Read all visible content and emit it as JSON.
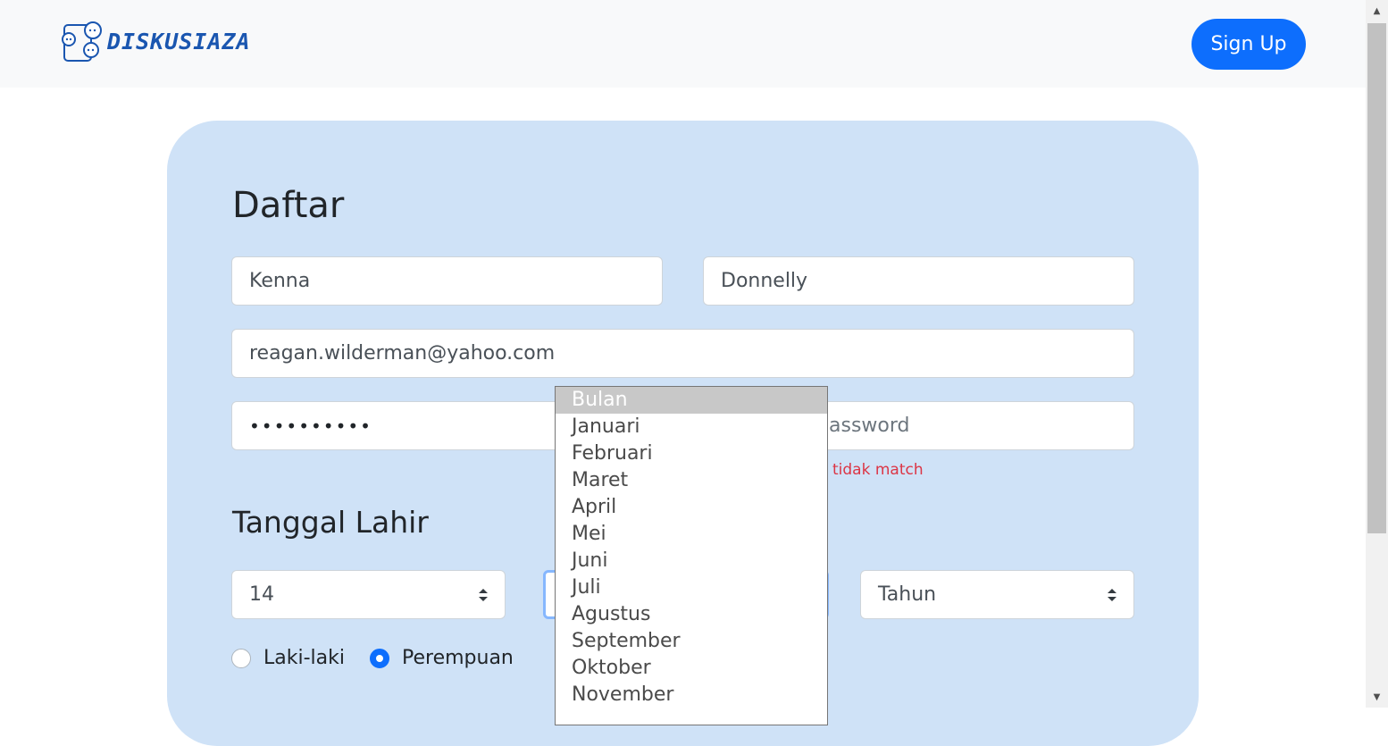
{
  "header": {
    "brand": "DISKUSIAZA",
    "signup_label": "Sign Up",
    "logo_icon": "chat-bubbles-icon"
  },
  "form": {
    "title": "Daftar",
    "first_name": "Kenna",
    "last_name": "Donnelly",
    "email": "reagan.wilderman@yahoo.com",
    "password_masked": "••••••••••",
    "confirm_password_placeholder_visible": "assword",
    "password_error_visible": "tidak match",
    "dob_title": "Tanggal Lahir",
    "day_value": "14",
    "year_value": "Tahun",
    "gender_options": [
      {
        "label": "Laki-laki",
        "checked": false
      },
      {
        "label": "Perempuan",
        "checked": true
      }
    ]
  },
  "month_dropdown": {
    "selected": "Bulan",
    "options": [
      "Bulan",
      "Januari",
      "Februari",
      "Maret",
      "April",
      "Mei",
      "Juni",
      "Juli",
      "Agustus",
      "September",
      "Oktober",
      "November"
    ]
  },
  "colors": {
    "brand_blue": "#1a56b0",
    "primary": "#0d6efd",
    "card_bg": "#cfe2f7",
    "error": "#dc3545"
  }
}
